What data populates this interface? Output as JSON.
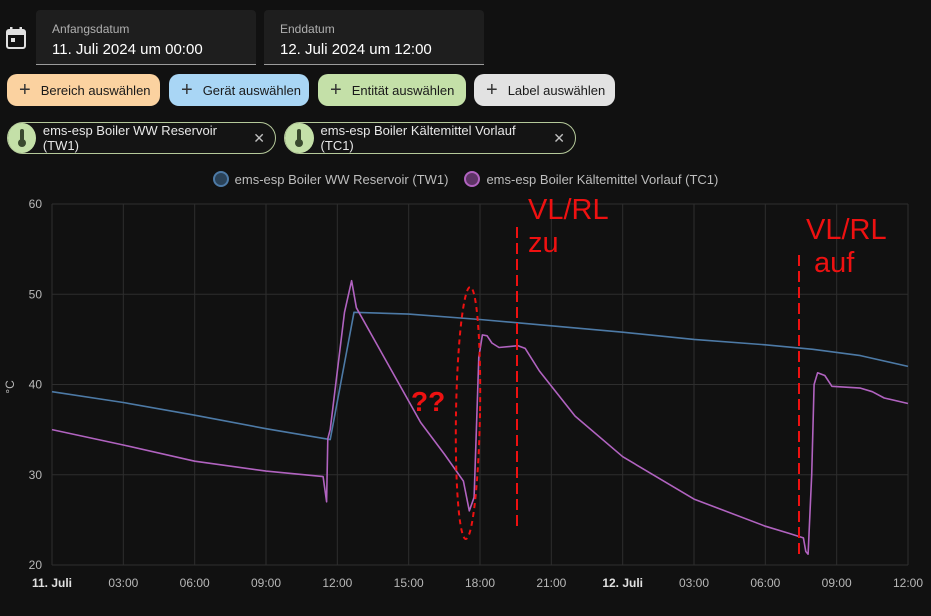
{
  "range": {
    "start_label": "Anfangsdatum",
    "start_value": "11. Juli 2024 um 00:00",
    "end_label": "Enddatum",
    "end_value": "12. Juli 2024 um 12:00"
  },
  "targets": [
    {
      "label": "Bereich auswählen",
      "color": "#fbd2a0"
    },
    {
      "label": "Gerät auswählen",
      "color": "#a9d6f5"
    },
    {
      "label": "Entität auswählen",
      "color": "#c4e0a8"
    },
    {
      "label": "Label auswählen",
      "color": "#e2e2e2"
    }
  ],
  "entities": [
    {
      "label": "ems-esp Boiler WW Reservoir (TW1)",
      "icon": "thermometer-icon"
    },
    {
      "label": "ems-esp Boiler Kältemittel Vorlauf (TC1)",
      "icon": "thermometer-icon"
    }
  ],
  "annotations": {
    "note1_line1": "VL/RL",
    "note1_line2": "zu",
    "note2_line1": "VL/RL",
    "note2_line2": "auf",
    "question": "??"
  },
  "chart_data": {
    "type": "line",
    "ylabel": "°C",
    "ylim": [
      20,
      60
    ],
    "yticks": [
      20,
      30,
      40,
      50,
      60
    ],
    "xlim": [
      0,
      36
    ],
    "xticks": [
      {
        "h": 0,
        "label": "11. Juli",
        "bold": true
      },
      {
        "h": 3,
        "label": "03:00"
      },
      {
        "h": 6,
        "label": "06:00"
      },
      {
        "h": 9,
        "label": "09:00"
      },
      {
        "h": 12,
        "label": "12:00"
      },
      {
        "h": 15,
        "label": "15:00"
      },
      {
        "h": 18,
        "label": "18:00"
      },
      {
        "h": 21,
        "label": "21:00"
      },
      {
        "h": 24,
        "label": "12. Juli",
        "bold": true
      },
      {
        "h": 27,
        "label": "03:00"
      },
      {
        "h": 30,
        "label": "06:00"
      },
      {
        "h": 33,
        "label": "09:00"
      },
      {
        "h": 36,
        "label": "12:00"
      }
    ],
    "series": [
      {
        "name": "ems-esp Boiler WW Reservoir (TW1)",
        "color": "#4d7aa6",
        "points": [
          [
            0,
            39.2
          ],
          [
            3,
            38.0
          ],
          [
            6,
            36.6
          ],
          [
            9,
            35.1
          ],
          [
            11.7,
            33.9
          ],
          [
            12.7,
            48.0
          ],
          [
            15,
            47.8
          ],
          [
            18,
            47.2
          ],
          [
            21,
            46.5
          ],
          [
            24,
            45.8
          ],
          [
            27,
            45.0
          ],
          [
            30,
            44.4
          ],
          [
            32,
            43.9
          ],
          [
            34,
            43.2
          ],
          [
            36,
            42.0
          ]
        ]
      },
      {
        "name": "ems-esp Boiler Kältemittel Vorlauf (TC1)",
        "color": "#b163c0",
        "points": [
          [
            0,
            35.0
          ],
          [
            3,
            33.3
          ],
          [
            6,
            31.5
          ],
          [
            9,
            30.4
          ],
          [
            11.4,
            29.8
          ],
          [
            11.55,
            27.0
          ],
          [
            11.6,
            34.0
          ],
          [
            11.7,
            35.0
          ],
          [
            12.3,
            48.0
          ],
          [
            12.6,
            51.5
          ],
          [
            12.8,
            48.5
          ],
          [
            15.5,
            35.8
          ],
          [
            16.5,
            32.3
          ],
          [
            17.3,
            29.3
          ],
          [
            17.55,
            26.0
          ],
          [
            17.75,
            27.5
          ],
          [
            17.95,
            43.0
          ],
          [
            18.1,
            45.5
          ],
          [
            18.3,
            45.4
          ],
          [
            18.5,
            44.6
          ],
          [
            18.8,
            44.1
          ],
          [
            19.6,
            44.3
          ],
          [
            19.9,
            44.0
          ],
          [
            20.5,
            41.5
          ],
          [
            22,
            36.5
          ],
          [
            24,
            32.0
          ],
          [
            27,
            27.3
          ],
          [
            30,
            24.3
          ],
          [
            31,
            23.5
          ],
          [
            31.6,
            23.0
          ],
          [
            31.7,
            21.5
          ],
          [
            31.8,
            21.2
          ],
          [
            31.95,
            30.0
          ],
          [
            32.05,
            40.0
          ],
          [
            32.2,
            41.3
          ],
          [
            32.5,
            41.0
          ],
          [
            32.8,
            39.8
          ],
          [
            34,
            39.6
          ],
          [
            34.5,
            39.2
          ],
          [
            35,
            38.5
          ],
          [
            36,
            37.9
          ]
        ]
      }
    ]
  }
}
